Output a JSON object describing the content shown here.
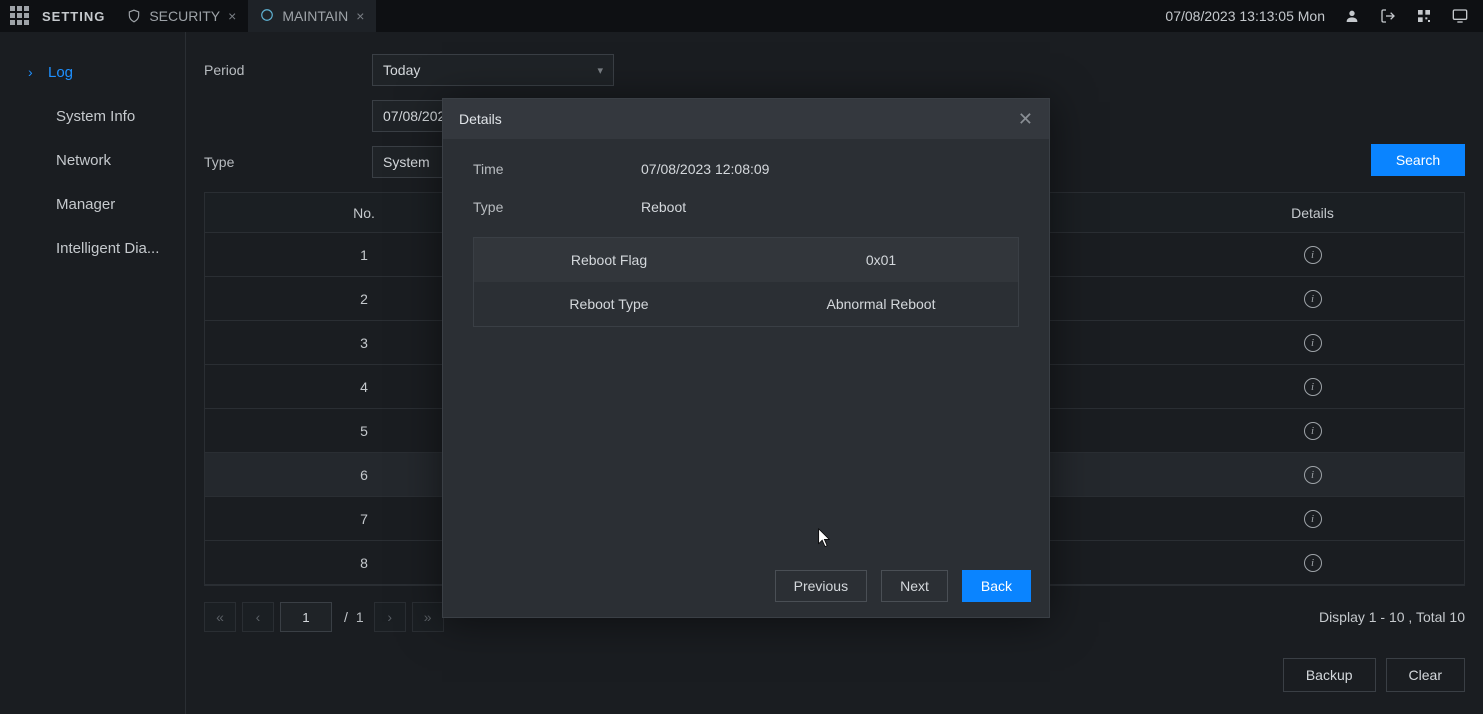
{
  "topbar": {
    "setting": "SETTING",
    "tab_security": "SECURITY",
    "tab_maintain": "MAINTAIN",
    "datetime": "07/08/2023 13:13:05 Mon"
  },
  "sidebar": {
    "items": [
      {
        "label": "Log",
        "active": true
      },
      {
        "label": "System Info"
      },
      {
        "label": "Network"
      },
      {
        "label": "Manager"
      },
      {
        "label": "Intelligent Dia..."
      }
    ]
  },
  "filters": {
    "period_label": "Period",
    "period_value": "Today",
    "date_value": "07/08/2023",
    "type_label": "Type",
    "type_value": "System",
    "search_label": "Search"
  },
  "table": {
    "headers": {
      "no": "No.",
      "details": "Details"
    },
    "rows": [
      {
        "no": "1"
      },
      {
        "no": "2"
      },
      {
        "no": "3"
      },
      {
        "no": "4"
      },
      {
        "no": "5"
      },
      {
        "no": "6",
        "highlight": true
      },
      {
        "no": "7"
      },
      {
        "no": "8"
      }
    ]
  },
  "pager": {
    "page": "1",
    "total_pages": "1",
    "status": "Display 1 - 10 , Total 10"
  },
  "bottom": {
    "backup": "Backup",
    "clear": "Clear"
  },
  "modal": {
    "title": "Details",
    "time_label": "Time",
    "time_value": "07/08/2023 12:08:09",
    "type_label": "Type",
    "type_value": "Reboot",
    "rows": [
      {
        "k": "Reboot Flag",
        "v": "0x01"
      },
      {
        "k": "Reboot Type",
        "v": "Abnormal Reboot"
      }
    ],
    "previous": "Previous",
    "next": "Next",
    "back": "Back"
  }
}
